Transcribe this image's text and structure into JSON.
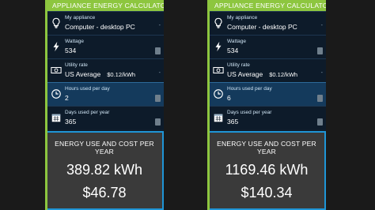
{
  "calculators": [
    {
      "header": "APPLIANCE ENERGY CALCULATOR",
      "appliance": {
        "label": "My appliance",
        "value": "Computer - desktop PC",
        "icon": "lightbulb-icon"
      },
      "wattage": {
        "label": "Wattage",
        "value": "534",
        "icon": "lightning-icon"
      },
      "utility": {
        "label": "Utility rate",
        "value": "US Average",
        "rate": "$0.12/kWh",
        "icon": "dollar-bill-icon"
      },
      "hours": {
        "label": "Hours used per day",
        "value": "2",
        "icon": "clock-icon"
      },
      "days": {
        "label": "Days used per year",
        "value": "365",
        "icon": "calendar-icon"
      },
      "result": {
        "title": "ENERGY USE AND COST PER YEAR",
        "energy": "389.82 kWh",
        "cost": "$46.78"
      }
    },
    {
      "header": "APPLIANCE ENERGY CALCULATOR",
      "appliance": {
        "label": "My appliance",
        "value": "Computer - desktop PC",
        "icon": "lightbulb-icon"
      },
      "wattage": {
        "label": "Wattage",
        "value": "534",
        "icon": "lightning-icon"
      },
      "utility": {
        "label": "Utility rate",
        "value": "US Average",
        "rate": "$0.12/kWh",
        "icon": "dollar-bill-icon"
      },
      "hours": {
        "label": "Hours used per day",
        "value": "6",
        "icon": "clock-icon"
      },
      "days": {
        "label": "Days used per year",
        "value": "365",
        "icon": "calendar-icon"
      },
      "result": {
        "title": "ENERGY USE AND COST PER YEAR",
        "energy": "1169.46 kWh",
        "cost": "$140.34"
      }
    }
  ],
  "colors": {
    "accent_green": "#8dc63f",
    "accent_blue": "#1f95d6",
    "panel_bg": "#0d1b2a",
    "active_row_bg": "#143a5c",
    "result_bg": "#3a3a3a"
  }
}
